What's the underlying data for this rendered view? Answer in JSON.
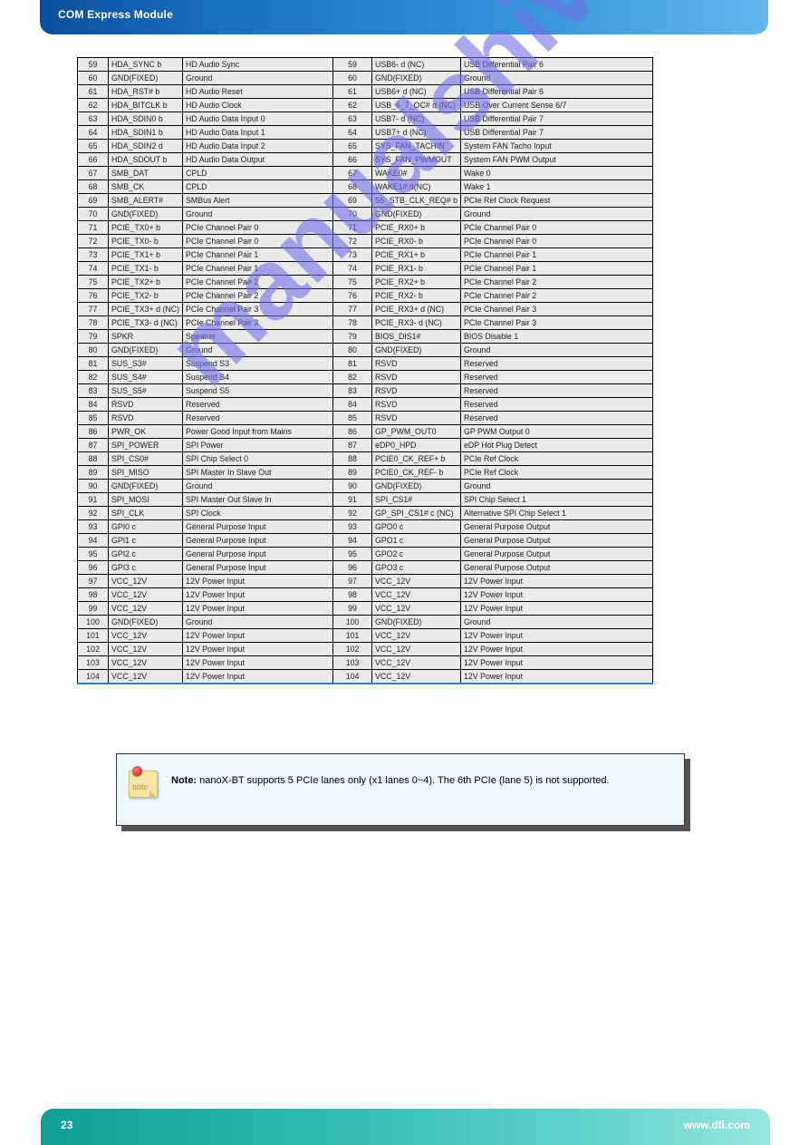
{
  "header": {
    "title": "COM Express Module"
  },
  "footer": {
    "page": "23",
    "site": "www.dfi.com"
  },
  "watermark": "manualshive.com",
  "noteIconLabel": "note",
  "note": {
    "bold": "Note:",
    "text": "nanoX-BT supports 5 PCIe lanes only (x1 lanes 0~4). The 6th PCIe (lane 5) is not supported."
  },
  "rows": [
    [
      "59",
      "HDA_SYNC b",
      "HD Audio Sync",
      "59",
      "USB6-  d (NC)",
      "USB Differential Pair 6"
    ],
    [
      "60",
      "GND(FIXED)",
      "Ground",
      "60",
      "GND(FIXED)",
      "Ground"
    ],
    [
      "61",
      "HDA_RST# b",
      "HD Audio Reset",
      "61",
      "USB6+  d (NC)",
      "USB Differential Pair 6"
    ],
    [
      "62",
      "HDA_BITCLK b",
      "HD Audio Clock",
      "62",
      "USB_6_7_OC# d (NC)",
      "USB Over Current Sense 6/7"
    ],
    [
      "63",
      "HDA_SDIN0 b",
      "HD Audio Data Input 0",
      "63",
      "USB7-  d (NC)",
      "USB Differential Pair 7"
    ],
    [
      "64",
      "HDA_SDIN1 b",
      "HD Audio Data Input 1",
      "64",
      "USB7+  d (NC)",
      "USB Differential Pair 7"
    ],
    [
      "65",
      "HDA_SDIN2 d",
      "HD Audio Data Input 2",
      "65",
      "SYS_FAN_TACHIN",
      "System FAN Tacho Input"
    ],
    [
      "66",
      "HDA_SDOUT b",
      "HD Audio Data Output",
      "66",
      "SYS_FAN_PWMOUT",
      "System FAN PWM Output"
    ],
    [
      "67",
      "SMB_DAT",
      "CPLD",
      "67",
      "WAKE0#",
      "Wake 0"
    ],
    [
      "68",
      "SMB_CK",
      "CPLD",
      "68",
      "WAKE1# d(NC)",
      "Wake 1"
    ],
    [
      "69",
      "SMB_ALERT#",
      "SMBus Alert",
      "69",
      "S5_STB_CLK_REQ# b",
      "PCIe Ref Clock Request"
    ],
    [
      "70",
      "GND(FIXED)",
      "Ground",
      "70",
      "GND(FIXED)",
      "Ground"
    ],
    [
      "71",
      "PCIE_TX0+ b",
      "PCIe Channel Pair 0",
      "71",
      "PCIE_RX0+ b",
      "PCIe Channel Pair 0"
    ],
    [
      "72",
      "PCIE_TX0- b",
      "PCIe Channel Pair 0",
      "72",
      "PCIE_RX0- b",
      "PCIe Channel Pair 0"
    ],
    [
      "73",
      "PCIE_TX1+ b",
      "PCIe Channel Pair 1",
      "73",
      "PCIE_RX1+ b",
      "PCIe Channel Pair 1"
    ],
    [
      "74",
      "PCIE_TX1- b",
      "PCIe Channel Pair 1",
      "74",
      "PCIE_RX1- b",
      "PCIe Channel Pair 1"
    ],
    [
      "75",
      "PCIE_TX2+ b",
      "PCIe Channel Pair 2",
      "75",
      "PCIE_RX2+ b",
      "PCIe Channel Pair 2"
    ],
    [
      "76",
      "PCIE_TX2- b",
      "PCIe Channel Pair 2",
      "76",
      "PCIE_RX2- b",
      "PCIe Channel Pair 2"
    ],
    [
      "77",
      "PCIE_TX3+ d (NC)",
      "PCIe Channel Pair 3",
      "77",
      "PCIE_RX3+ d (NC)",
      "PCIe Channel Pair 3"
    ],
    [
      "78",
      "PCIE_TX3- d (NC)",
      "PCIe Channel Pair 3",
      "78",
      "PCIE_RX3- d (NC)",
      "PCIe Channel Pair 3"
    ],
    [
      "79",
      "SPKR",
      "Speaker",
      "79",
      "BIOS_DIS1#",
      "BIOS Disable 1"
    ],
    [
      "80",
      "GND(FIXED)",
      "Ground",
      "80",
      "GND(FIXED)",
      "Ground"
    ],
    [
      "81",
      "SUS_S3#",
      "Suspend S3",
      "81",
      "RSVD",
      "Reserved"
    ],
    [
      "82",
      "SUS_S4#",
      "Suspend S4",
      "82",
      "RSVD",
      "Reserved"
    ],
    [
      "83",
      "SUS_S5#",
      "Suspend S5",
      "83",
      "RSVD",
      "Reserved"
    ],
    [
      "84",
      "RSVD",
      "Reserved",
      "84",
      "RSVD",
      "Reserved"
    ],
    [
      "85",
      "RSVD",
      "Reserved",
      "85",
      "RSVD",
      "Reserved"
    ],
    [
      "86",
      "PWR_OK",
      "Power Good Input from Mains",
      "86",
      "GP_PWM_OUT0",
      "GP PWM Output 0"
    ],
    [
      "87",
      "SPI_POWER",
      "SPI Power",
      "87",
      "eDP0_HPD",
      "eDP Hot Plug Detect"
    ],
    [
      "88",
      "SPI_CS0#",
      "SPI Chip Select 0",
      "88",
      "PCIE0_CK_REF+ b",
      "PCIe Ref Clock"
    ],
    [
      "89",
      "SPI_MISO",
      "SPI Master In Slave Out",
      "89",
      "PCIE0_CK_REF- b",
      "PCIe Ref Clock"
    ],
    [
      "90",
      "GND(FIXED)",
      "Ground",
      "90",
      "GND(FIXED)",
      "Ground"
    ],
    [
      "91",
      "SPI_MOSI",
      "SPI Master Out Slave In",
      "91",
      "SPI_CS1#",
      "SPI Chip Select 1"
    ],
    [
      "92",
      "SPI_CLK",
      "SPI Clock",
      "92",
      "GP_SPI_CS1# c (NC)",
      "Alternative SPI Chip Select 1"
    ],
    [
      "93",
      "GPI0 c",
      "General Purpose Input",
      "93",
      "GPO0 c",
      "General Purpose Output"
    ],
    [
      "94",
      "GPI1 c",
      "General Purpose Input",
      "94",
      "GPO1 c",
      "General Purpose Output"
    ],
    [
      "95",
      "GPI2 c",
      "General Purpose Input",
      "95",
      "GPO2 c",
      "General Purpose Output"
    ],
    [
      "96",
      "GPI3 c",
      "General Purpose Input",
      "96",
      "GPO3 c",
      "General Purpose Output"
    ],
    [
      "97",
      "VCC_12V",
      "12V Power Input",
      "97",
      "VCC_12V",
      "12V Power Input"
    ],
    [
      "98",
      "VCC_12V",
      "12V Power Input",
      "98",
      "VCC_12V",
      "12V Power Input"
    ],
    [
      "99",
      "VCC_12V",
      "12V Power Input",
      "99",
      "VCC_12V",
      "12V Power Input"
    ],
    [
      "100",
      "GND(FIXED)",
      "Ground",
      "100",
      "GND(FIXED)",
      "Ground"
    ],
    [
      "101",
      "VCC_12V",
      "12V Power Input",
      "101",
      "VCC_12V",
      "12V Power Input"
    ],
    [
      "102",
      "VCC_12V",
      "12V Power Input",
      "102",
      "VCC_12V",
      "12V Power Input"
    ],
    [
      "103",
      "VCC_12V",
      "12V Power Input",
      "103",
      "VCC_12V",
      "12V Power Input"
    ],
    [
      "104",
      "VCC_12V",
      "12V Power Input",
      "104",
      "VCC_12V",
      "12V Power Input"
    ]
  ]
}
